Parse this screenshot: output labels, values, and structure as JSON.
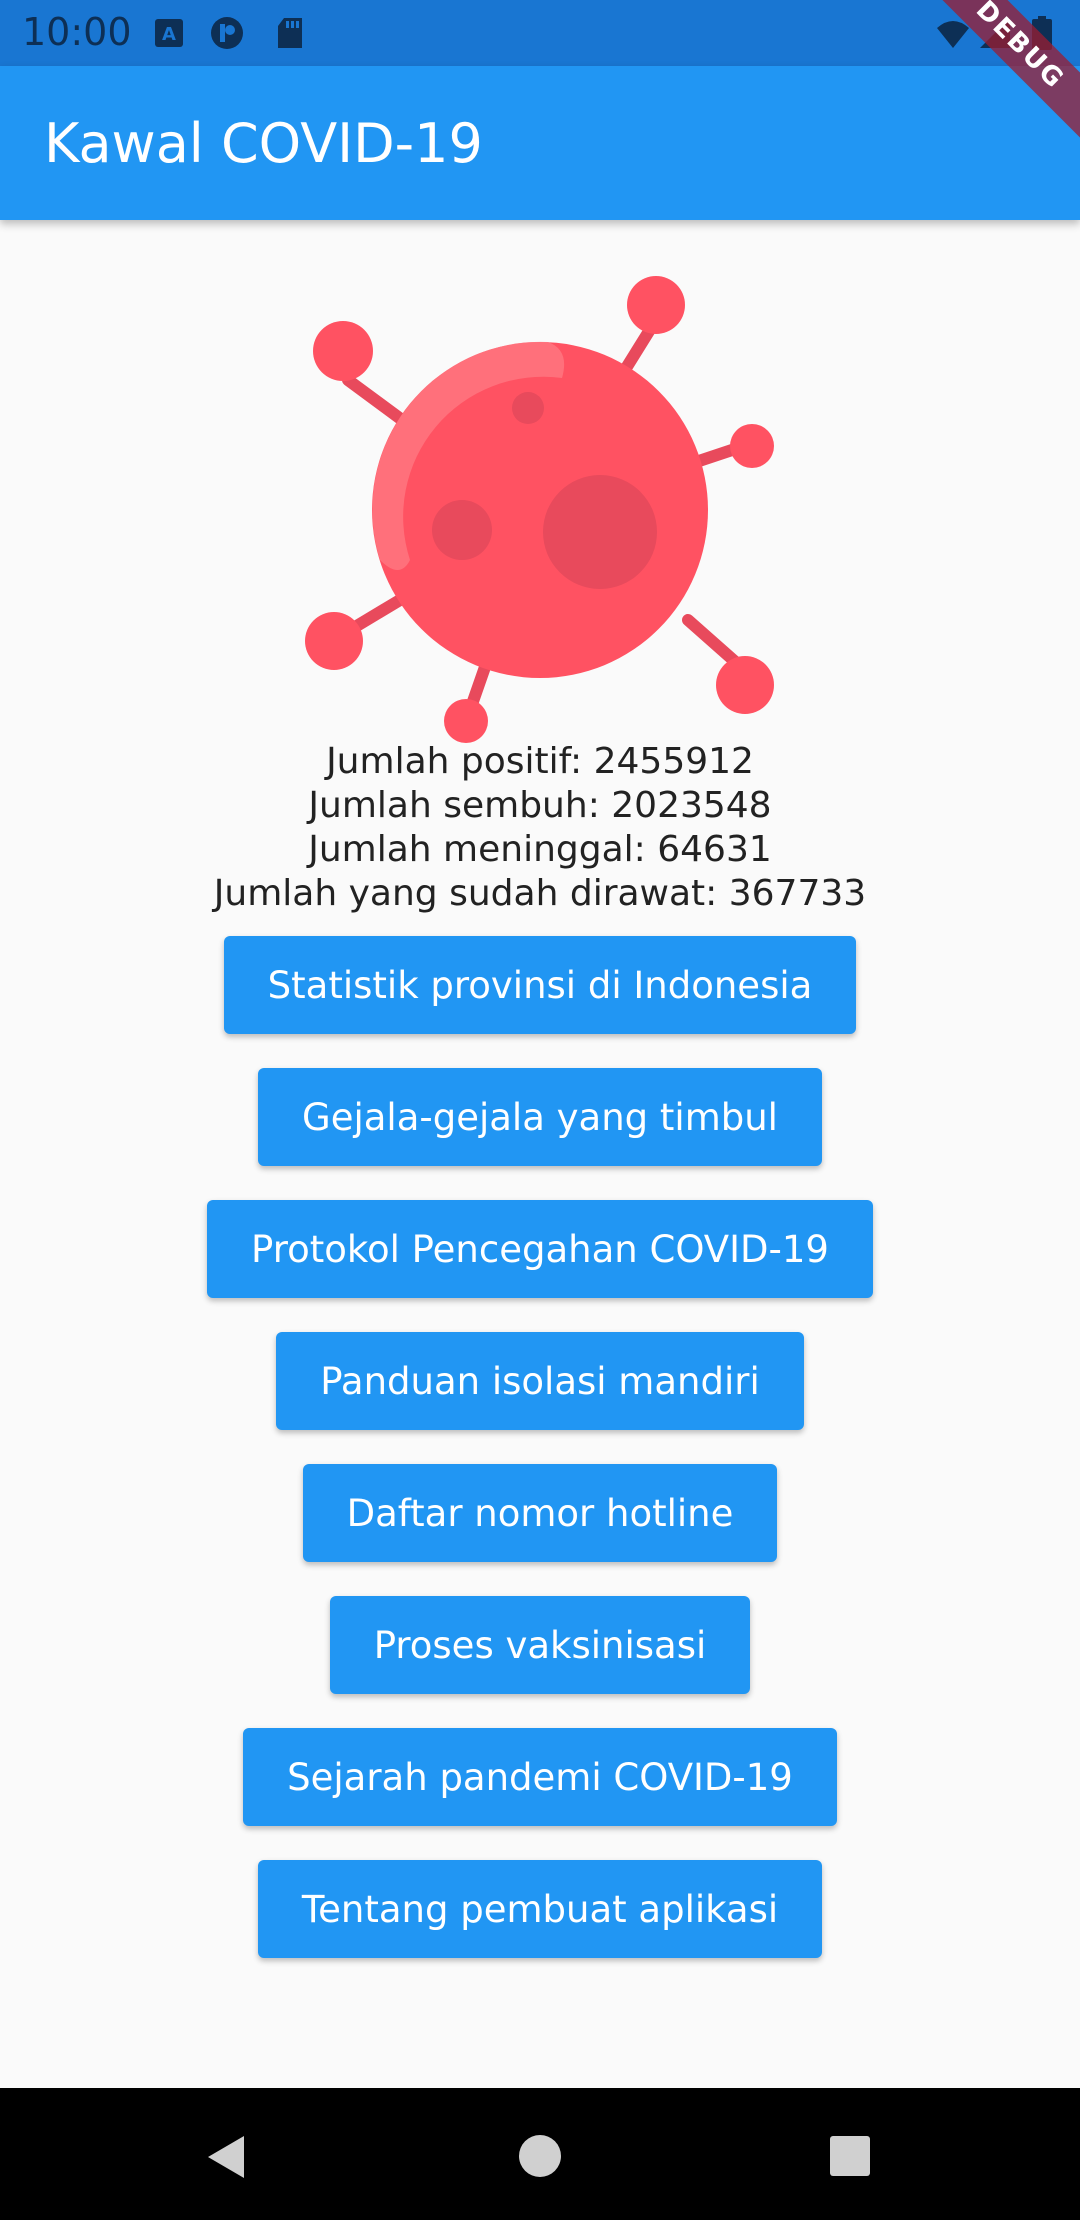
{
  "status_bar": {
    "time": "10:00",
    "icons": [
      "keyboard-a-icon",
      "app-p-icon",
      "sd-card-icon",
      "wifi-icon",
      "signal-icon",
      "battery-icon"
    ]
  },
  "app_bar": {
    "title": "Kawal COVID-19",
    "debug_label": "DEBUG"
  },
  "illustration": {
    "icon": "virus-icon",
    "color": "#ff5262"
  },
  "stats": {
    "positive": "Jumlah positif: 2455912",
    "recovered": "Jumlah sembuh: 2023548",
    "deaths": "Jumlah meninggal: 64631",
    "treated": "Jumlah yang sudah dirawat: 367733"
  },
  "menu": [
    {
      "label": "Statistik provinsi di Indonesia"
    },
    {
      "label": "Gejala-gejala yang timbul"
    },
    {
      "label": "Protokol Pencegahan COVID-19"
    },
    {
      "label": "Panduan isolasi mandiri"
    },
    {
      "label": "Daftar nomor hotline"
    },
    {
      "label": "Proses vaksinisasi"
    },
    {
      "label": "Sejarah pandemi COVID-19"
    },
    {
      "label": "Tentang pembuat aplikasi"
    }
  ],
  "colors": {
    "primary": "#2196f3",
    "status_bar": "#1976d2",
    "background": "#fafafa"
  },
  "nav_bar": {
    "icons": [
      "back-icon",
      "home-icon",
      "recents-icon"
    ]
  }
}
